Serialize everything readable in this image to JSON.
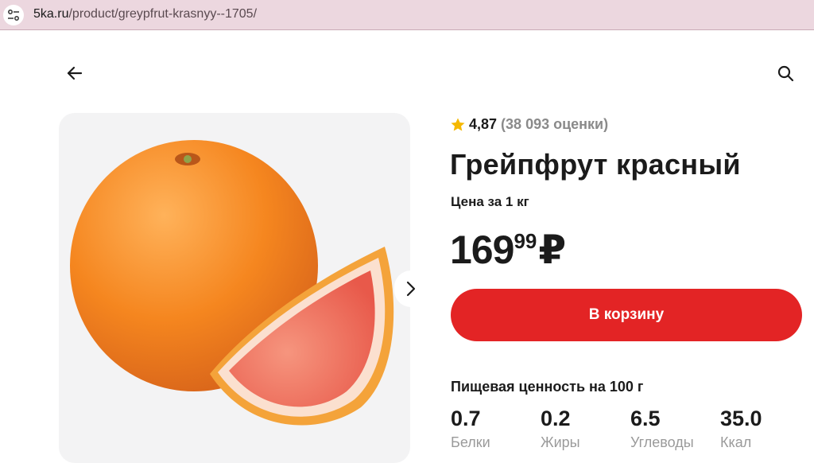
{
  "browser": {
    "url_domain": "5ka.ru",
    "url_path": "/product/greypfrut-krasnyy--1705/"
  },
  "product": {
    "rating": "4,87",
    "rating_count": "(38 093 оценки)",
    "title": "Грейпфрут красный",
    "unit_label": "Цена за 1 кг",
    "price_rub": "169",
    "price_kop": "99",
    "currency": "₽",
    "cart_button": "В корзину"
  },
  "nutrition": {
    "title": "Пищевая ценность на 100 г",
    "items": [
      {
        "value": "0.7",
        "label": "Белки"
      },
      {
        "value": "0.2",
        "label": "Жиры"
      },
      {
        "value": "6.5",
        "label": "Углеводы"
      },
      {
        "value": "35.0",
        "label": "Ккал"
      }
    ]
  },
  "colors": {
    "accent": "#e32425",
    "star": "#f5b800",
    "urlbar": "#ecd7df"
  }
}
